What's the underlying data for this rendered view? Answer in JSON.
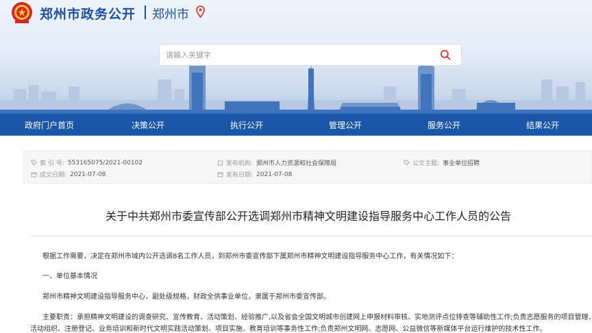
{
  "header": {
    "site_title": "郑州市政务公开",
    "city": "郑州市",
    "emblem_icon": "national-emblem-icon",
    "location_icon": "location-pin-icon"
  },
  "search": {
    "placeholder": "请输入关键字",
    "button_icon": "search-icon"
  },
  "nav": {
    "items": [
      {
        "label": "政府门户首页"
      },
      {
        "label": "决策公开"
      },
      {
        "label": "执行公开"
      },
      {
        "label": "管理公开"
      },
      {
        "label": "服务公开"
      },
      {
        "label": "结果公开"
      }
    ]
  },
  "meta": {
    "index_label": "索 引 号:",
    "index_value": "553165075/2021-00102",
    "publisher_label": "发布机构:",
    "publisher_value": "郑州市人力资源和社会保障局",
    "topic_label": "公文主题:",
    "topic_value": "事业单位招聘",
    "created_label": "成文日期:",
    "created_value": "2021-07-08",
    "published_label": "发布日期:",
    "published_value": "2021-07-08"
  },
  "article": {
    "title": "关于中共郑州市委宣传部公开选调郑州市精神文明建设指导服务中心工作人员的公告",
    "paragraphs": [
      "根据工作需要，决定在郑州市域内公开选调8名工作人员，到郑州市委宣传部下属郑州市精神文明建设指导服务中心工作，有关情况如下：",
      "一、单位基本情况",
      "郑州市精神文明建设指导服务中心，副处级规格，财政全供事业单位，隶属于郑州市委宣传部。",
      "主要职责：承担精神文明建设的调查研究、宣传教育、活动策划、经验推广,以及省会全国文明城市创建网上申报材料审核、实地测评点位排查等辅助性工作;负责志愿服务的项目管理、",
      "活动组织、注册登记、业务培训和新时代文明实践活动策划、项目实施、教育培训等事务性工作;负责郑州文明网、志愿网、公益微信等新媒体平台运行维护的技术性工作。"
    ]
  },
  "colors": {
    "brand_blue": "#1a57a8",
    "title_blue": "#1a4ea0",
    "pin_red": "#e03a2e"
  }
}
